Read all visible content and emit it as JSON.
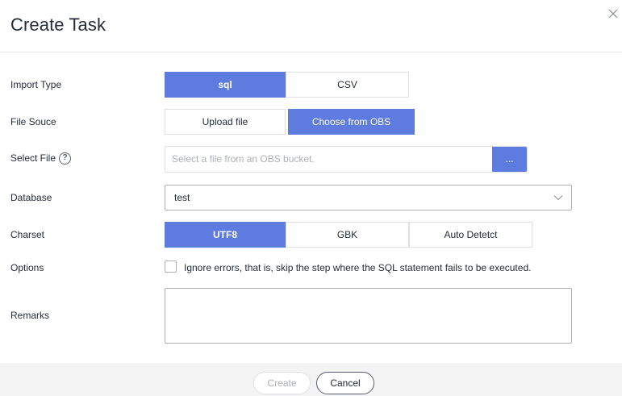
{
  "dialog": {
    "title": "Create Task"
  },
  "form": {
    "import_type": {
      "label": "Import Type",
      "options": [
        "sql",
        "CSV"
      ],
      "selected": "sql"
    },
    "file_source": {
      "label": "File Souce",
      "options": [
        "Upload file",
        "Choose from OBS"
      ],
      "selected": "Choose from OBS"
    },
    "select_file": {
      "label": "Select File",
      "help_glyph": "?",
      "placeholder": "Select a file from an OBS bucket.",
      "browse_label": "..."
    },
    "database": {
      "label": "Database",
      "value": "test"
    },
    "charset": {
      "label": "Charset",
      "options": [
        "UTF8",
        "GBK",
        "Auto Detetct"
      ],
      "selected": "UTF8"
    },
    "options": {
      "label": "Options",
      "checkbox_label": "Ignore errors, that is, skip the step where the SQL statement fails to be executed.",
      "checked": false
    },
    "remarks": {
      "label": "Remarks",
      "value": ""
    }
  },
  "footer": {
    "create_label": "Create",
    "cancel_label": "Cancel"
  },
  "colors": {
    "accent": "#5e7ce0",
    "footer_bg": "#f3f3f4",
    "text": "#252b3a",
    "placeholder": "#adb0b8"
  },
  "icons": {
    "close": "close-icon",
    "help": "help-circle-icon",
    "dropdown": "chevron-down-icon"
  }
}
